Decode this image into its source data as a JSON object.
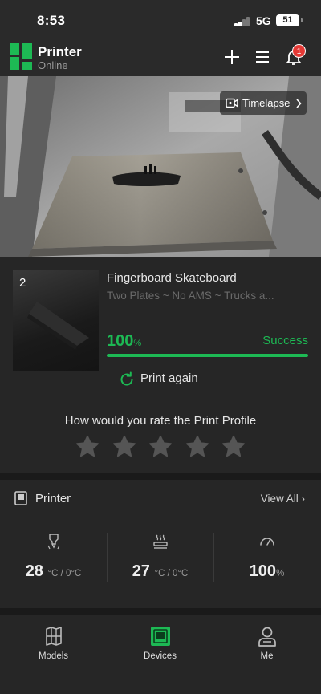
{
  "status_bar": {
    "time": "8:53",
    "network": "5G",
    "battery": "51"
  },
  "header": {
    "title": "Printer",
    "subtitle": "Online",
    "notification_count": "1",
    "accent_color": "#1db954"
  },
  "camera": {
    "timelapse_label": "Timelapse"
  },
  "job": {
    "plate_number": "2",
    "title": "Fingerboard Skateboard",
    "subtitle": "Two Plates ~ No AMS ~ Trucks a...",
    "progress_value": "100",
    "progress_unit": "%",
    "progress_fraction": 1.0,
    "status": "Success",
    "print_again": "Print again",
    "rating_question": "How would you rate the Print Profile",
    "star_count": 5
  },
  "printer": {
    "title": "Printer",
    "view_all": "View All",
    "nozzle": {
      "value": "28",
      "unit": "°C / 0°C",
      "icon": "nozzle-icon"
    },
    "bed": {
      "value": "27",
      "unit": "°C / 0°C",
      "icon": "heatbed-icon"
    },
    "speed": {
      "value": "100",
      "unit": "%",
      "icon": "speedometer-icon"
    }
  },
  "tabs": [
    {
      "label": "Models",
      "icon": "models-icon"
    },
    {
      "label": "Devices",
      "icon": "devices-icon"
    },
    {
      "label": "Me",
      "icon": "profile-icon"
    }
  ]
}
